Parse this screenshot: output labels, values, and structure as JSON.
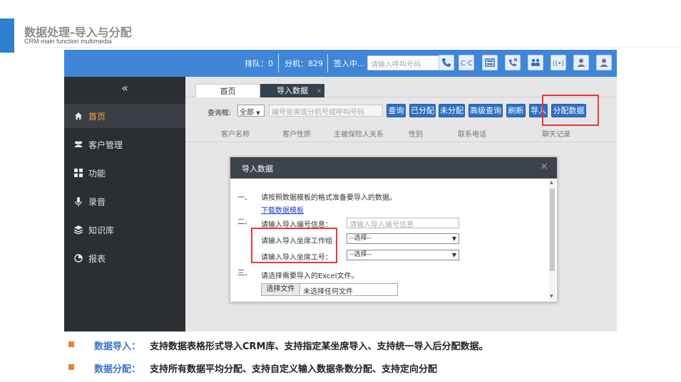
{
  "slide": {
    "title": "数据处理-导入与分配",
    "subtitle": "CRM main function multimedia"
  },
  "topbar": {
    "queue": "排队：0",
    "extension": "分机：829",
    "status": "签入中...",
    "call_placeholder": "请输入呼叫号码",
    "accent": "#3f86d8"
  },
  "sidebar": {
    "collapse": "«",
    "items": [
      {
        "label": "首页",
        "icon": "home-icon"
      },
      {
        "label": "客户管理",
        "icon": "users-icon"
      },
      {
        "label": "功能",
        "icon": "grid-icon"
      },
      {
        "label": "录音",
        "icon": "microphone-icon"
      },
      {
        "label": "知识库",
        "icon": "layers-icon"
      },
      {
        "label": "报表",
        "icon": "pie-chart-icon"
      }
    ]
  },
  "tabs": [
    {
      "label": "首页"
    },
    {
      "label": "导入数据",
      "close": "×"
    }
  ],
  "query": {
    "label": "查询框:",
    "scope_value": "全部",
    "input_placeholder": "编号坐席或分机号或呼叫号码",
    "buttons": [
      "查询",
      "已分配",
      "未分配",
      "高级查询",
      "刷新",
      "导入",
      "分配数据"
    ]
  },
  "grid_headers": [
    "客户名称",
    "客户性质",
    "主被保险人关系",
    "性别",
    "联系电话",
    "聊天记录"
  ],
  "modal": {
    "title": "导入数据",
    "close": "×",
    "steps": [
      {
        "num": "一、",
        "text": "请按照数据模板的格式准备要导入的数据。",
        "link": "下载数据模板"
      },
      {
        "num": "二、",
        "text": "请输入导入编号信息：",
        "placeholder": "请输入导入编号信息",
        "group_label": "请输入导入坐席工作组",
        "group_value": "--选择--",
        "agent_label": "请输入导入坐席工号：",
        "agent_value": "--选择--"
      },
      {
        "num": "三、",
        "text": "请选择需要导入的Excel文件。",
        "file_button": "选择文件",
        "file_text": "未选择任何文件"
      }
    ]
  },
  "bullets": [
    {
      "key": "数据导入：",
      "text": "支持数据表格形式导入CRM库、支持指定某坐席导入、支持统一导入后分配数据。"
    },
    {
      "key": "数据分配：",
      "text": "支持所有数据平均分配、支持自定义输入数据条数分配、支持定向分配"
    }
  ]
}
